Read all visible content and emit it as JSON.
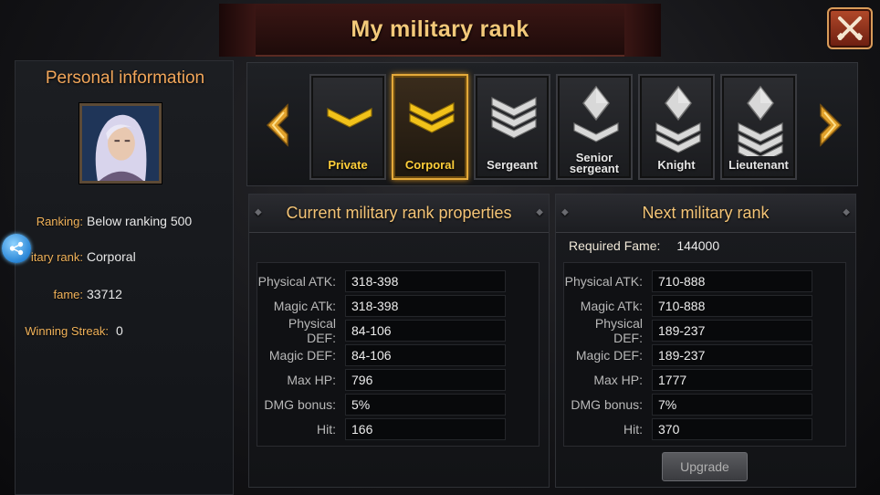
{
  "window": {
    "title": "My military rank"
  },
  "personal": {
    "header": "Personal information",
    "ranking_label": "Ranking:",
    "ranking_value": "Below ranking 500",
    "rank_label": "Military rank:",
    "rank_label_visible": "itary rank:",
    "rank_value": "Corporal",
    "fame_label": "fame:",
    "fame_value": "33712",
    "streak_label": "Winning Streak:",
    "streak_value": "0"
  },
  "ranks": [
    {
      "name": "Private",
      "color": "gold",
      "chevrons": 1,
      "diamond": false,
      "active": false
    },
    {
      "name": "Corporal",
      "color": "gold",
      "chevrons": 2,
      "diamond": false,
      "active": true
    },
    {
      "name": "Sergeant",
      "color": "silver",
      "chevrons": 3,
      "diamond": false,
      "active": false
    },
    {
      "name": "Senior sergeant",
      "line1": "Senior",
      "line2": "sergeant",
      "color": "silver",
      "chevrons": 1,
      "diamond": true,
      "active": false
    },
    {
      "name": "Knight",
      "color": "silver",
      "chevrons": 2,
      "diamond": true,
      "active": false
    },
    {
      "name": "Lieutenant",
      "color": "silver",
      "chevrons": 3,
      "diamond": true,
      "active": false
    }
  ],
  "current": {
    "header": "Current military rank properties",
    "stats": [
      {
        "label": "Physical ATK:",
        "value": "318-398"
      },
      {
        "label": "Magic ATk:",
        "value": "318-398"
      },
      {
        "label": "Physical DEF:",
        "value": "84-106"
      },
      {
        "label": "Magic DEF:",
        "value": "84-106"
      },
      {
        "label": "Max HP:",
        "value": "796"
      },
      {
        "label": "DMG bonus:",
        "value": "5%"
      },
      {
        "label": "Hit:",
        "value": "166"
      }
    ]
  },
  "next": {
    "header": "Next military rank",
    "required_label": "Required Fame:",
    "required_value": "144000",
    "stats": [
      {
        "label": "Physical ATK:",
        "value": "710-888"
      },
      {
        "label": "Magic ATk:",
        "value": "710-888"
      },
      {
        "label": "Physical DEF:",
        "value": "189-237"
      },
      {
        "label": "Magic DEF:",
        "value": "189-237"
      },
      {
        "label": "Max HP:",
        "value": "1777"
      },
      {
        "label": "DMG bonus:",
        "value": "7%"
      },
      {
        "label": "Hit:",
        "value": "370"
      }
    ],
    "upgrade_label": "Upgrade"
  },
  "colors": {
    "title": "#f3c97a",
    "gold_rank": "#ffcf3a",
    "silver_rank": "#e6e6e6",
    "active_border": "#e4a93a"
  }
}
